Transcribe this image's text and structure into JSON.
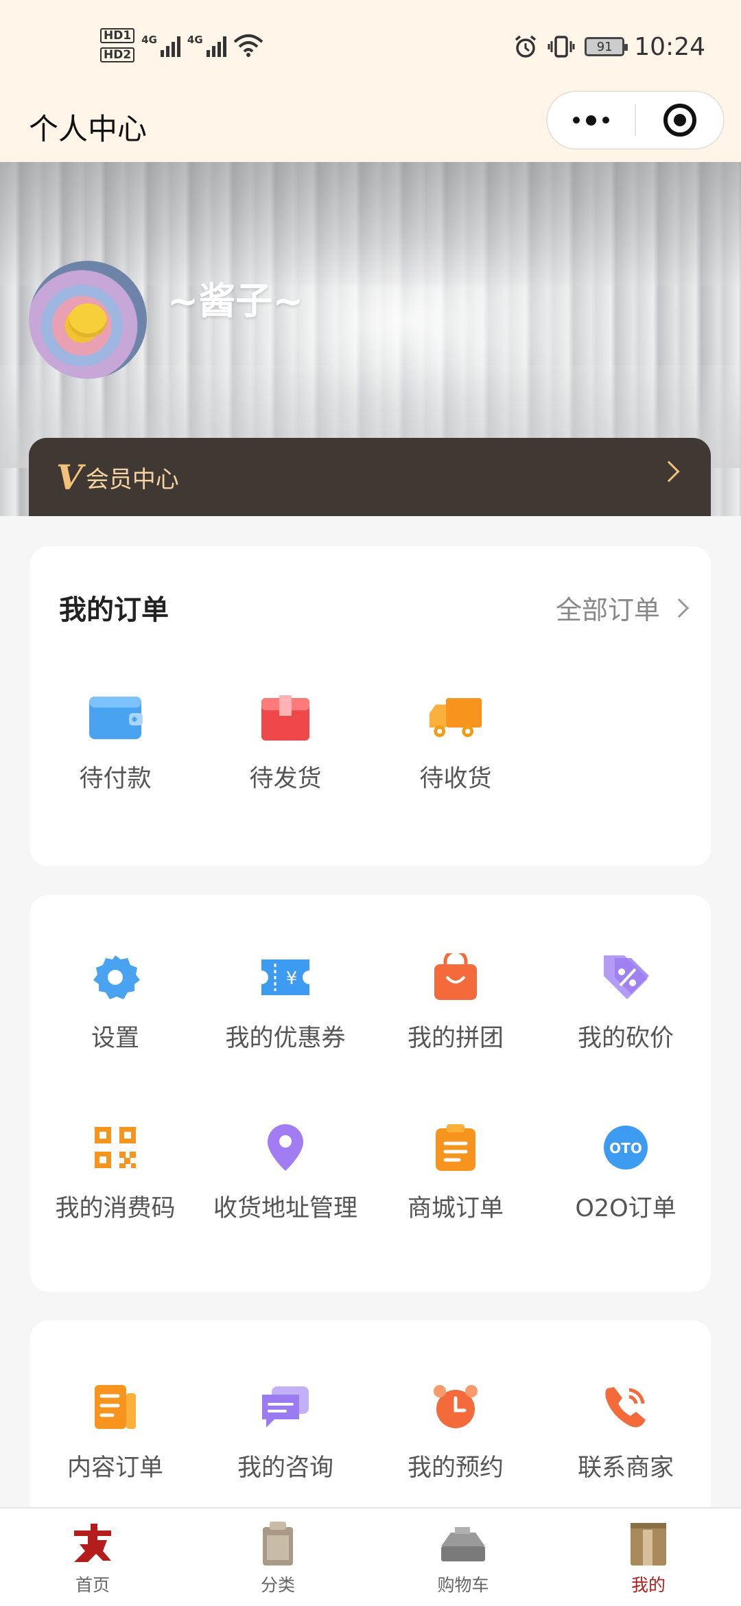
{
  "status_bar": {
    "hd1": "HD1",
    "hd2": "HD2",
    "network1": "4G",
    "network2": "4G",
    "battery": "91",
    "time": "10:24"
  },
  "header": {
    "title": "个人中心"
  },
  "profile": {
    "username": "~酱子~",
    "member_v": "V",
    "member_label": "会员中心"
  },
  "orders": {
    "title": "我的订单",
    "all_label": "全部订单",
    "items": [
      {
        "label": "待付款",
        "icon": "wallet-icon",
        "color": "#4aa3f0"
      },
      {
        "label": "待发货",
        "icon": "box-icon",
        "color": "#f0474b"
      },
      {
        "label": "待收货",
        "icon": "truck-icon",
        "color": "#f7941d"
      }
    ]
  },
  "services": {
    "items": [
      {
        "label": "设置",
        "icon": "gear-icon",
        "color": "#4aa3f0"
      },
      {
        "label": "我的优惠券",
        "icon": "coupon-icon",
        "color": "#3d9cf2"
      },
      {
        "label": "我的拼团",
        "icon": "shopping-bag-icon",
        "color": "#f46a3a"
      },
      {
        "label": "我的砍价",
        "icon": "discount-tag-icon",
        "color": "#9b7cf0"
      },
      {
        "label": "我的消费码",
        "icon": "qr-code-icon",
        "color": "#f7941d"
      },
      {
        "label": "收货地址管理",
        "icon": "location-pin-icon",
        "color": "#a27cf2"
      },
      {
        "label": "商城订单",
        "icon": "clipboard-icon",
        "color": "#f7941d"
      },
      {
        "label": "O2O订单",
        "icon": "oto-icon",
        "color": "#3d9cf2"
      }
    ]
  },
  "more": {
    "items": [
      {
        "label": "内容订单",
        "icon": "document-icon",
        "color": "#f7941d"
      },
      {
        "label": "我的咨询",
        "icon": "chat-icon",
        "color": "#9b7cf0"
      },
      {
        "label": "我的预约",
        "icon": "alarm-clock-icon",
        "color": "#f46a3a"
      },
      {
        "label": "联系商家",
        "icon": "phone-icon",
        "color": "#f46a3a"
      }
    ]
  },
  "tabbar": {
    "items": [
      {
        "label": "首页",
        "icon": "home-icon",
        "active": false
      },
      {
        "label": "分类",
        "icon": "category-icon",
        "active": false
      },
      {
        "label": "购物车",
        "icon": "cart-icon",
        "active": false
      },
      {
        "label": "我的",
        "icon": "profile-icon",
        "active": true
      }
    ]
  },
  "colors": {
    "header_bg": "#fff5e8",
    "member_bar_bg": "#3f3833",
    "member_accent": "#f1c27a",
    "active_tab": "#b51d1d"
  }
}
